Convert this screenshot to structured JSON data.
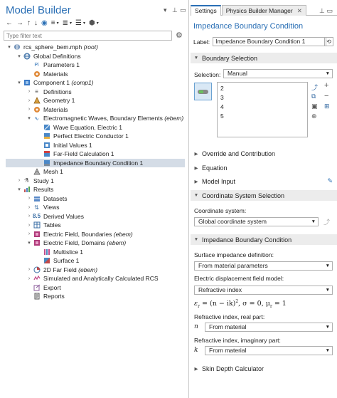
{
  "model_builder": {
    "title": "Model Builder",
    "filter_placeholder": "Type filter text",
    "tree": [
      {
        "label": "rcs_sphere_bem.mph",
        "suffix": "(root)",
        "toggle": "▾"
      },
      {
        "label": "Global Definitions",
        "toggle": "▾"
      },
      {
        "label": "Parameters 1",
        "icon_text": "Pi"
      },
      {
        "label": "Materials"
      },
      {
        "label": "Component 1",
        "suffix": "(comp1)",
        "toggle": "▾"
      },
      {
        "label": "Definitions",
        "toggle": "›"
      },
      {
        "label": "Geometry 1",
        "toggle": "›"
      },
      {
        "label": "Materials",
        "toggle": "›"
      },
      {
        "label": "Electromagnetic Waves, Boundary Elements",
        "suffix": "(ebem)",
        "toggle": "▾"
      },
      {
        "label": "Wave Equation, Electric 1"
      },
      {
        "label": "Perfect Electric Conductor 1"
      },
      {
        "label": "Initial Values 1"
      },
      {
        "label": "Far-Field Calculation 1"
      },
      {
        "label": "Impedance Boundary Condition 1"
      },
      {
        "label": "Mesh 1"
      },
      {
        "label": "Study 1",
        "toggle": "›"
      },
      {
        "label": "Results",
        "toggle": "▾"
      },
      {
        "label": "Datasets",
        "toggle": "›"
      },
      {
        "label": "Views",
        "toggle": "›"
      },
      {
        "label": "Derived Values",
        "toggle": "›"
      },
      {
        "label": "Tables",
        "toggle": "›"
      },
      {
        "label": "Electric Field, Boundaries",
        "suffix": "(ebem)",
        "toggle": "›"
      },
      {
        "label": "Electric Field, Domains",
        "suffix": "(ebem)",
        "toggle": "▾"
      },
      {
        "label": "Multislice 1"
      },
      {
        "label": "Surface 1"
      },
      {
        "label": "2D Far Field",
        "suffix": "(ebem)",
        "toggle": "›"
      },
      {
        "label": "Simulated and Analytically Calculated RCS",
        "toggle": "›"
      },
      {
        "label": "Export"
      },
      {
        "label": "Reports"
      }
    ]
  },
  "settings": {
    "tabs": [
      {
        "label": "Settings"
      },
      {
        "label": "Physics Builder Manager",
        "close": "✕"
      }
    ],
    "title": "Impedance Boundary Condition",
    "label_caption": "Label:",
    "label_value": "Impedance Boundary Condition 1",
    "sections": {
      "boundary_selection": "Boundary Selection",
      "override": "Override and Contribution",
      "equation": "Equation",
      "model_input": "Model Input",
      "coordinate_system": "Coordinate System Selection",
      "ibc": "Impedance Boundary Condition",
      "skin_depth": "Skin Depth Calculator"
    },
    "selection_caption": "Selection:",
    "selection_value": "Manual",
    "selection_list": [
      "2",
      "3",
      "4",
      "5"
    ],
    "coordinate_caption": "Coordinate system:",
    "coordinate_value": "Global coordinate system",
    "surface_caption": "Surface impedance definition:",
    "surface_value": "From material parameters",
    "disp_caption": "Electric displacement field model:",
    "disp_value": "Refractive index",
    "formula": {
      "eps": "ε",
      "eps_sub": "r",
      "mid": " = (n − ik)",
      "sup": "2",
      "sigma": ",  σ = 0,  μ",
      "mu_sub": "r",
      "end": " = 1"
    },
    "n_real_caption": "Refractive index, real part:",
    "n_symbol": "n",
    "n_value": "From material",
    "n_imag_caption": "Refractive index, imaginary part:",
    "k_symbol": "k",
    "k_value": "From material"
  },
  "colors": {
    "accent": "#2a6fb5",
    "selected_row": "#d4dce6",
    "section_bg": "#ececec"
  }
}
